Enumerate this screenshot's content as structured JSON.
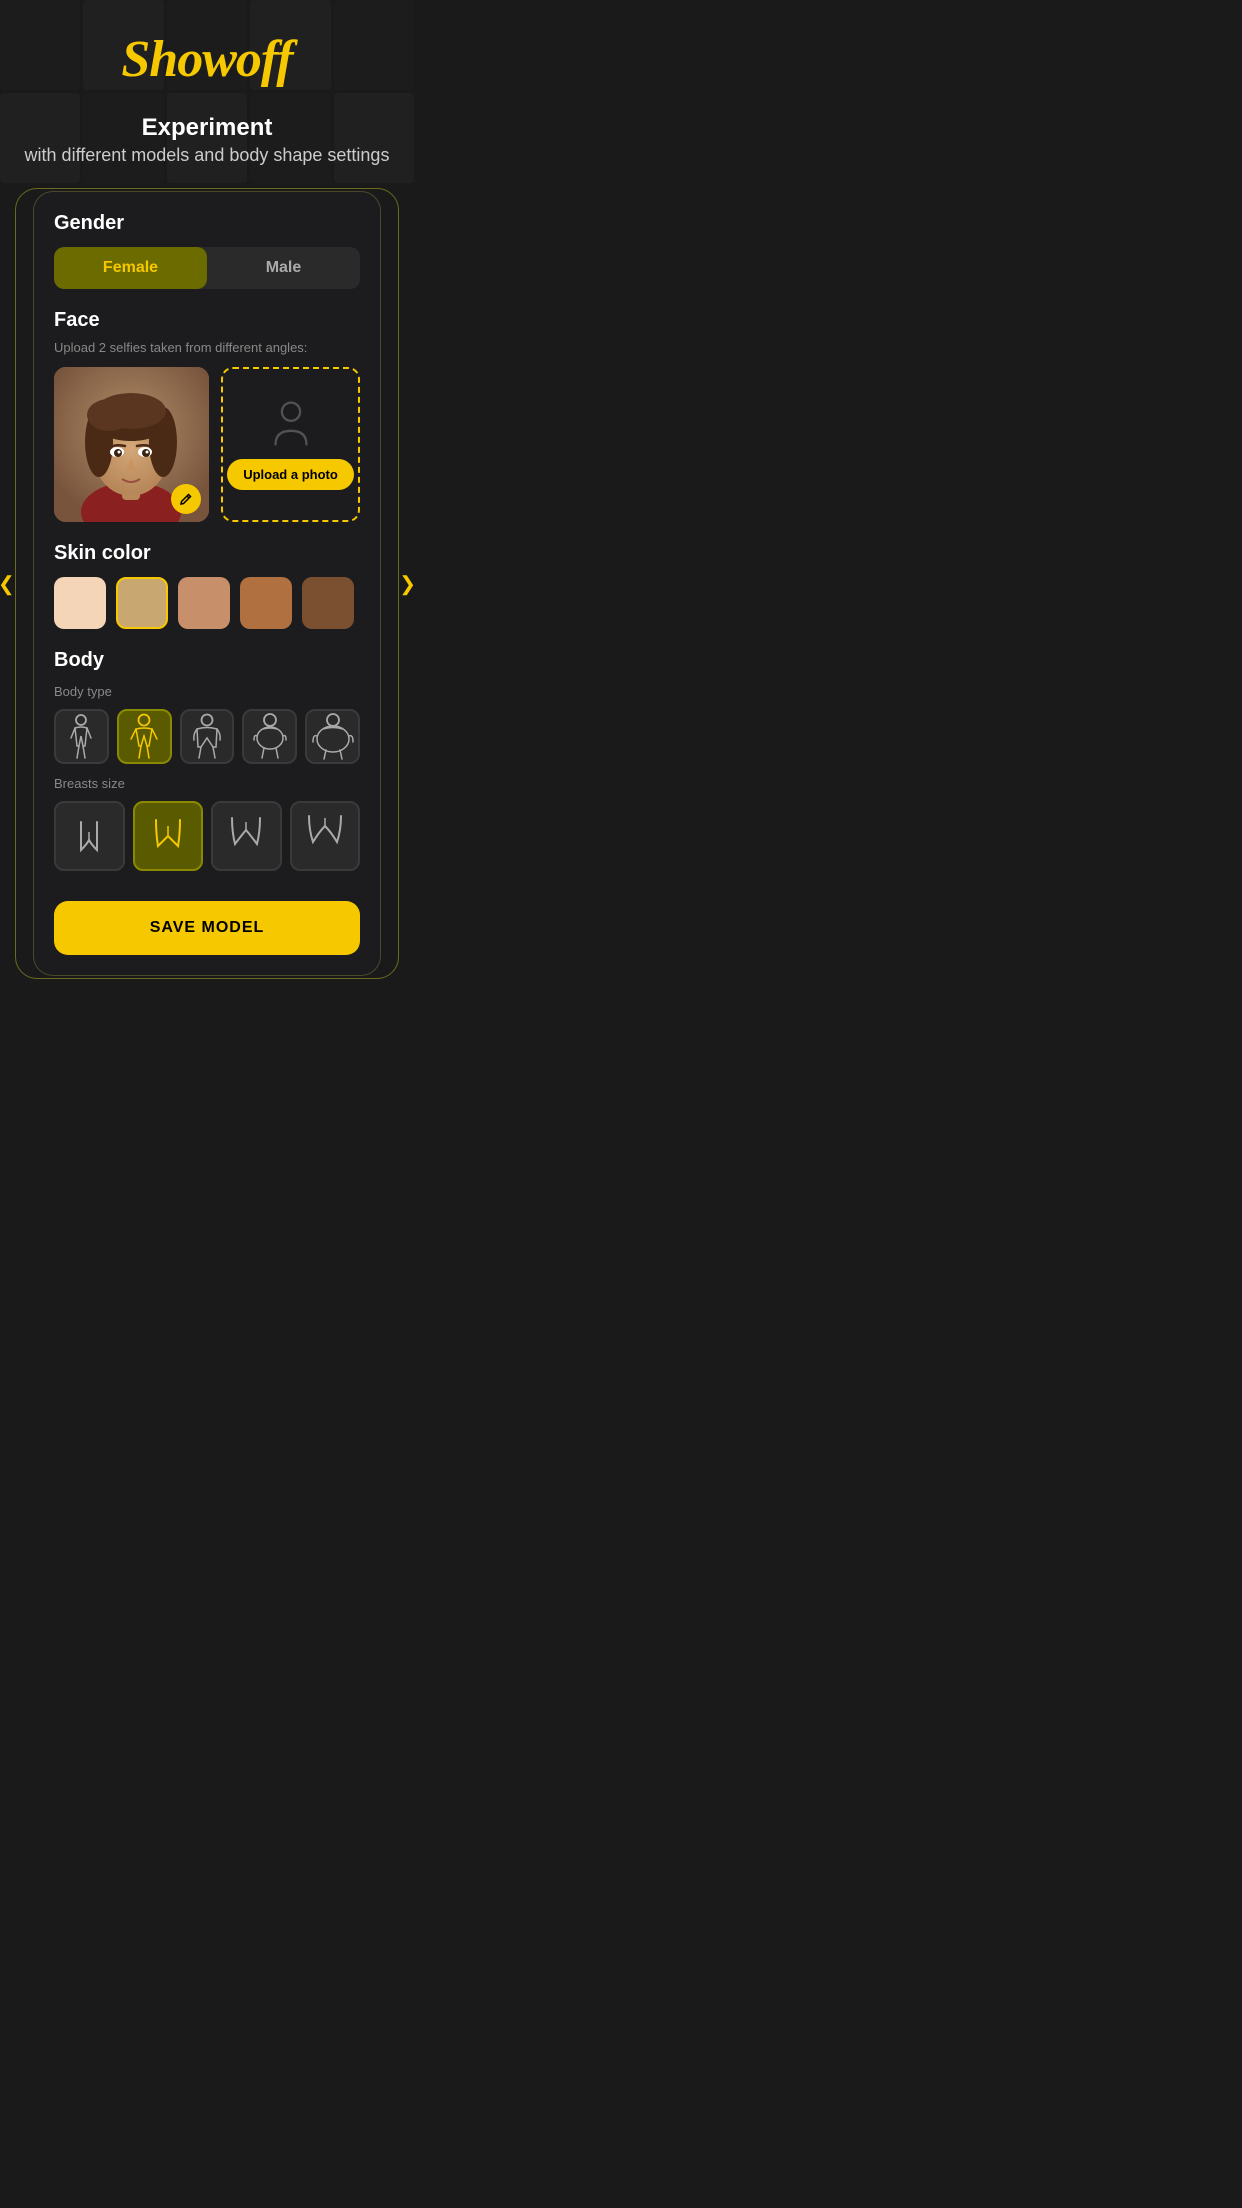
{
  "header": {
    "app_title": "Showoff",
    "subtitle_main": "Experiment",
    "subtitle_sub": "with different models and body shape settings"
  },
  "card": {
    "gender_label": "Gender",
    "gender_options": [
      {
        "id": "female",
        "label": "Female",
        "active": true
      },
      {
        "id": "male",
        "label": "Male",
        "active": false
      }
    ],
    "face_label": "Face",
    "face_hint": "Upload 2 selfies taken from different angles:",
    "upload_photo_label": "Upload a photo",
    "skin_color_label": "Skin color",
    "skin_colors": [
      {
        "id": "s1",
        "hex": "#f5d5b8",
        "selected": false
      },
      {
        "id": "s2",
        "hex": "#c8a870",
        "selected": false
      },
      {
        "id": "s3",
        "hex": "#c8906a",
        "selected": false
      },
      {
        "id": "s4",
        "hex": "#b07040",
        "selected": false
      },
      {
        "id": "s5",
        "hex": "#7a5030",
        "selected": false
      }
    ],
    "body_label": "Body",
    "body_type_label": "Body type",
    "body_types": [
      {
        "id": "bt1",
        "active": false
      },
      {
        "id": "bt2",
        "active": true
      },
      {
        "id": "bt3",
        "active": false
      },
      {
        "id": "bt4",
        "active": false
      },
      {
        "id": "bt5",
        "active": false
      }
    ],
    "breasts_size_label": "Breasts size",
    "breast_sizes": [
      {
        "id": "bs1",
        "active": false
      },
      {
        "id": "bs2",
        "active": true
      },
      {
        "id": "bs3",
        "active": false
      },
      {
        "id": "bs4",
        "active": false
      }
    ],
    "save_button_label": "SAVE MODEL"
  },
  "icons": {
    "edit": "✏️",
    "arrow_left": "❮",
    "arrow_right": "❯"
  }
}
